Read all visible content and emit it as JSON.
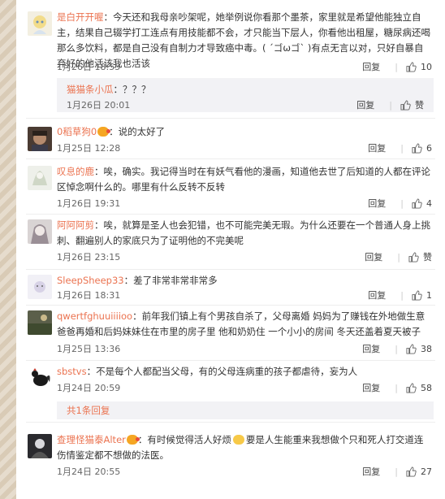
{
  "comments": [
    {
      "user": "是白开开喔",
      "text": "：今天还和我母亲吵架呢，她举例说你看那个墨茶，家里就是希望他能独立自主，结果自己辍学打工连点有用技能都不会，才只能当下层人，你看他出租屋，糖尿病还喝那么多饮料，都是自己没有自制力才导致癌中毒。( ´ゴωゴ` )有点无言以对，只好自暴自弃好的他活该我也活该",
      "time": "1月26日 18:55",
      "reply": "回复",
      "likes": "10",
      "sub": {
        "user": "猫猫条小瓜",
        "text": "：？？？",
        "time": "1月26日 20:01",
        "reply": "回复",
        "likes": "赞"
      }
    },
    {
      "user": "0稻草狗0",
      "text": "：说的太好了",
      "time": "1月25日 12:28",
      "reply": "回复",
      "likes": "6"
    },
    {
      "user": "叹息的鹿",
      "text": "：唉，确实。我记得当时在有妖气看他的漫画，知道他去世了后知道的人都在评论区悼念啊什么的。哪里有什么反转不反转",
      "time": "1月26日 19:31",
      "reply": "回复",
      "likes": "4"
    },
    {
      "user": "阿阿阿剪",
      "text": "：唉，就算是圣人也会犯错，也不可能完美无瑕。为什么还要在一个普通人身上挑刺、翻遍别人的家底只为了证明他的不完美呢",
      "time": "1月26日 23:15",
      "reply": "回复",
      "likes": "赞"
    },
    {
      "user": "SleepSheep33",
      "text": "：差了非常非常非常多",
      "time": "1月26日 18:31",
      "reply": "回复",
      "likes": "1"
    },
    {
      "user": "qwertfghuuiiiioo",
      "text": "：前年我们镇上有个男孩自杀了，父母离婚 妈妈为了赚钱在外地做生意 爸爸再婚和后妈妹妹住在市里的房子里 他和奶奶住 一个小小的房间 冬天还盖着夏天被子",
      "time": "1月25日 13:36",
      "reply": "回复",
      "likes": "38"
    },
    {
      "user": "sbstvs",
      "text": "：不是每个人都配当父母，有的父母连病重的孩子都虐待，妄为人",
      "time": "1月24日 20:59",
      "reply": "回复",
      "likes": "58",
      "more": "共1条回复"
    },
    {
      "user": "查理怪猫泰Alter",
      "text_a": "：有时候觉得活人好烦",
      "text_b": "要是人生能重来我想做个只和死人打交道连伤情鉴定都不想做的法医。",
      "time": "1月24日 20:55",
      "reply": "回复",
      "likes": "27"
    }
  ]
}
